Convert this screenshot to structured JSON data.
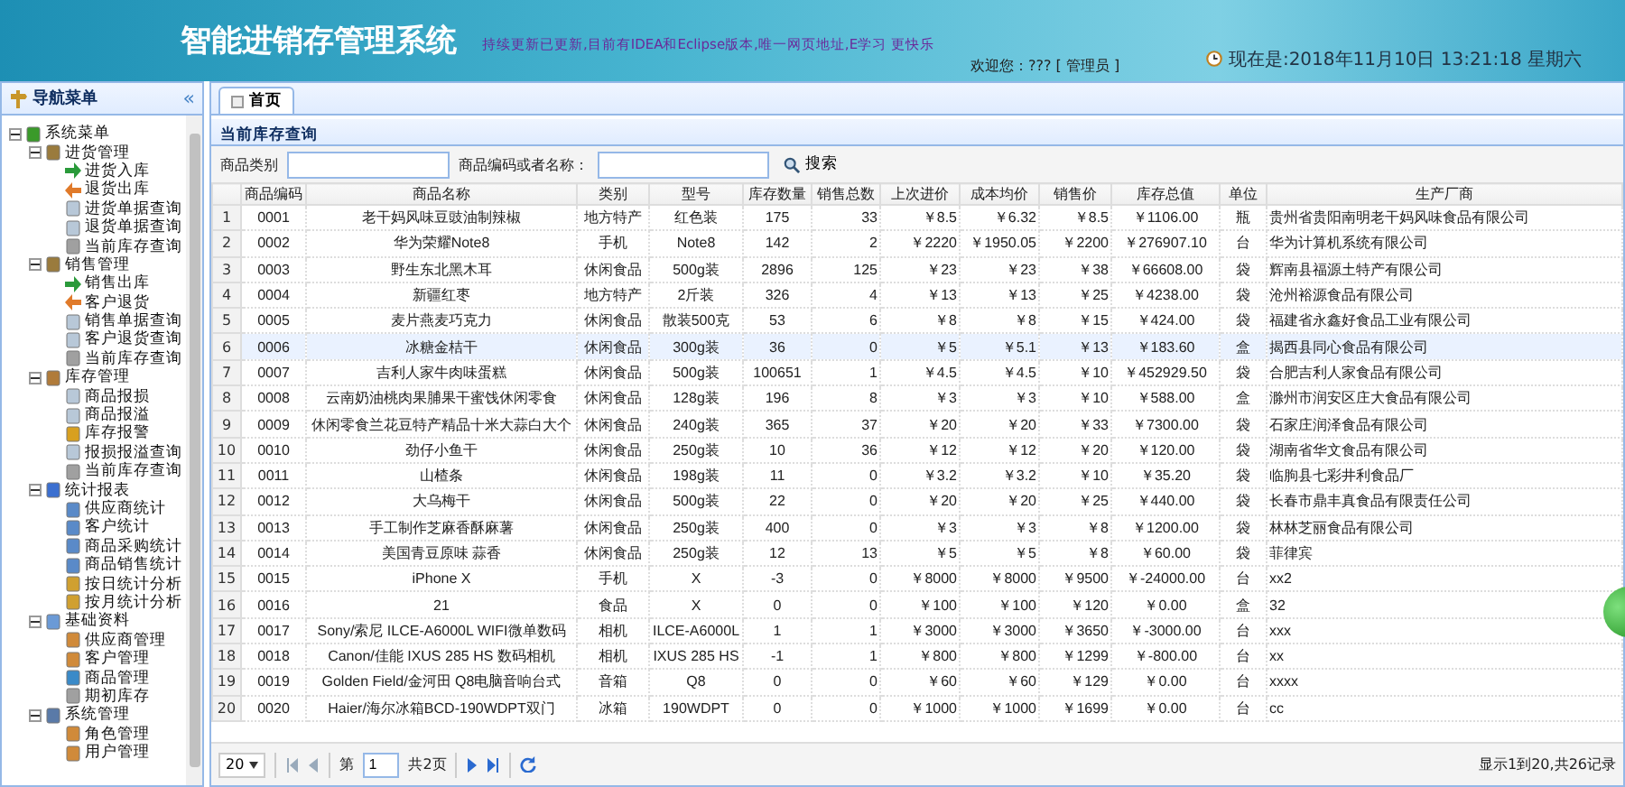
{
  "header": {
    "title": "智能进销存管理系统",
    "notice": "持续更新已更新,目前有IDEA和Eclipse版本,唯一网页地址,E学习 更快乐",
    "welcome": "欢迎您：??? [ 管理员 ]",
    "clock": "现在是:2018年11月10日 13:21:18 星期六"
  },
  "sidebar": {
    "title": "导航菜单",
    "collapse": "«",
    "tree": [
      {
        "label": "系统菜单",
        "expanded": true,
        "kind": "root",
        "children": [
          {
            "label": "进货管理",
            "expanded": true,
            "kind": "group",
            "children": [
              {
                "label": "进货入库",
                "kind": "in"
              },
              {
                "label": "退货出库",
                "kind": "out"
              },
              {
                "label": "进货单据查询",
                "kind": "doc"
              },
              {
                "label": "退货单据查询",
                "kind": "doc"
              },
              {
                "label": "当前库存查询",
                "kind": "db"
              }
            ]
          },
          {
            "label": "销售管理",
            "expanded": true,
            "kind": "group",
            "children": [
              {
                "label": "销售出库",
                "kind": "in"
              },
              {
                "label": "客户退货",
                "kind": "out"
              },
              {
                "label": "销售单据查询",
                "kind": "doc"
              },
              {
                "label": "客户退货查询",
                "kind": "doc"
              },
              {
                "label": "当前库存查询",
                "kind": "db"
              }
            ]
          },
          {
            "label": "库存管理",
            "expanded": true,
            "kind": "folder",
            "children": [
              {
                "label": "商品报损",
                "kind": "doc"
              },
              {
                "label": "商品报溢",
                "kind": "doc"
              },
              {
                "label": "库存报警",
                "kind": "warn"
              },
              {
                "label": "报损报溢查询",
                "kind": "doc"
              },
              {
                "label": "当前库存查询",
                "kind": "db"
              }
            ]
          },
          {
            "label": "统计报表",
            "expanded": true,
            "kind": "chart",
            "children": [
              {
                "label": "供应商统计",
                "kind": "stat"
              },
              {
                "label": "客户统计",
                "kind": "stat"
              },
              {
                "label": "商品采购统计",
                "kind": "stat"
              },
              {
                "label": "商品销售统计",
                "kind": "stat"
              },
              {
                "label": "按日统计分析",
                "kind": "bars"
              },
              {
                "label": "按月统计分析",
                "kind": "bars"
              }
            ]
          },
          {
            "label": "基础资料",
            "expanded": true,
            "kind": "table",
            "children": [
              {
                "label": "供应商管理",
                "kind": "user"
              },
              {
                "label": "客户管理",
                "kind": "user"
              },
              {
                "label": "商品管理",
                "kind": "tree"
              },
              {
                "label": "期初库存",
                "kind": "db"
              }
            ]
          },
          {
            "label": "系统管理",
            "expanded": true,
            "kind": "pc",
            "children": [
              {
                "label": "角色管理",
                "kind": "user"
              },
              {
                "label": "用户管理",
                "kind": "user"
              }
            ]
          }
        ]
      }
    ]
  },
  "tabs": [
    {
      "label": "首页",
      "selected": true
    }
  ],
  "panel": {
    "title": "当前库存查询",
    "search": {
      "category_label": "商品类别",
      "keyword_label": "商品编码或者名称：",
      "button": "搜索"
    },
    "columns": [
      "商品编码",
      "商品名称",
      "类别",
      "型号",
      "库存数量",
      "销售总数",
      "上次进价",
      "成本均价",
      "销售价",
      "库存总值",
      "单位",
      "生产厂商"
    ],
    "rows": [
      {
        "n": "1",
        "cells": [
          "0001",
          "老干妈风味豆豉油制辣椒",
          "地方特产",
          "红色装",
          "175",
          "33",
          "￥8.5",
          "￥6.32",
          "￥8.5",
          "￥1106.00",
          "瓶",
          "贵州省贵阳南明老干妈风味食品有限公司"
        ],
        "selected": false
      },
      {
        "n": "2",
        "cells": [
          "0002",
          "华为荣耀Note8",
          "手机",
          "Note8",
          "142",
          "2",
          "￥2220",
          "￥1950.05",
          "￥2200",
          "￥276907.10",
          "台",
          "华为计算机系统有限公司"
        ],
        "selected": false
      },
      {
        "n": "3",
        "cells": [
          "0003",
          "野生东北黑木耳",
          "休闲食品",
          "500g装",
          "2896",
          "125",
          "￥23",
          "￥23",
          "￥38",
          "￥66608.00",
          "袋",
          "辉南县福源土特产有限公司"
        ],
        "selected": false
      },
      {
        "n": "4",
        "cells": [
          "0004",
          "新疆红枣",
          "地方特产",
          "2斤装",
          "326",
          "4",
          "￥13",
          "￥13",
          "￥25",
          "￥4238.00",
          "袋",
          "沧州裕源食品有限公司"
        ],
        "selected": false
      },
      {
        "n": "5",
        "cells": [
          "0005",
          "麦片燕麦巧克力",
          "休闲食品",
          "散装500克",
          "53",
          "6",
          "￥8",
          "￥8",
          "￥15",
          "￥424.00",
          "袋",
          "福建省永鑫好食品工业有限公司"
        ],
        "selected": false
      },
      {
        "n": "6",
        "cells": [
          "0006",
          "冰糖金桔干",
          "休闲食品",
          "300g装",
          "36",
          "0",
          "￥5",
          "￥5.1",
          "￥13",
          "￥183.60",
          "盒",
          "揭西县同心食品有限公司"
        ],
        "selected": true
      },
      {
        "n": "7",
        "cells": [
          "0007",
          "吉利人家牛肉味蛋糕",
          "休闲食品",
          "500g装",
          "100651",
          "1",
          "￥4.5",
          "￥4.5",
          "￥10",
          "￥452929.50",
          "袋",
          "合肥吉利人家食品有限公司"
        ],
        "selected": false
      },
      {
        "n": "8",
        "cells": [
          "0008",
          "云南奶油桃肉果脯果干蜜饯休闲零食",
          "休闲食品",
          "128g装",
          "196",
          "8",
          "￥3",
          "￥3",
          "￥10",
          "￥588.00",
          "盒",
          "滁州市润安区庄大食品有限公司"
        ],
        "selected": false
      },
      {
        "n": "9",
        "cells": [
          "0009",
          "休闲零食兰花豆特产精品十米大蒜白大个",
          "休闲食品",
          "240g装",
          "365",
          "37",
          "￥20",
          "￥20",
          "￥33",
          "￥7300.00",
          "袋",
          "石家庄润泽食品有限公司"
        ],
        "selected": false
      },
      {
        "n": "10",
        "cells": [
          "0010",
          "劲仔小鱼干",
          "休闲食品",
          "250g装",
          "10",
          "36",
          "￥12",
          "￥12",
          "￥20",
          "￥120.00",
          "袋",
          "湖南省华文食品有限公司"
        ],
        "selected": false
      },
      {
        "n": "11",
        "cells": [
          "0011",
          "山楂条",
          "休闲食品",
          "198g装",
          "11",
          "0",
          "￥3.2",
          "￥3.2",
          "￥10",
          "￥35.20",
          "袋",
          "临朐县七彩井利食品厂"
        ],
        "selected": false
      },
      {
        "n": "12",
        "cells": [
          "0012",
          "大乌梅干",
          "休闲食品",
          "500g装",
          "22",
          "0",
          "￥20",
          "￥20",
          "￥25",
          "￥440.00",
          "袋",
          "长春市鼎丰真食品有限责任公司"
        ],
        "selected": false
      },
      {
        "n": "13",
        "cells": [
          "0013",
          "手工制作芝麻香酥麻薯",
          "休闲食品",
          "250g装",
          "400",
          "0",
          "￥3",
          "￥3",
          "￥8",
          "￥1200.00",
          "袋",
          "林林芝丽食品有限公司"
        ],
        "selected": false
      },
      {
        "n": "14",
        "cells": [
          "0014",
          "美国青豆原味 蒜香",
          "休闲食品",
          "250g装",
          "12",
          "13",
          "￥5",
          "￥5",
          "￥8",
          "￥60.00",
          "袋",
          "菲律宾"
        ],
        "selected": false
      },
      {
        "n": "15",
        "cells": [
          "0015",
          "iPhone X",
          "手机",
          "X",
          "-3",
          "0",
          "￥8000",
          "￥8000",
          "￥9500",
          "￥-24000.00",
          "台",
          "xx2"
        ],
        "selected": false
      },
      {
        "n": "16",
        "cells": [
          "0016",
          "21",
          "食品",
          "X",
          "0",
          "0",
          "￥100",
          "￥100",
          "￥120",
          "￥0.00",
          "盒",
          "32"
        ],
        "selected": false
      },
      {
        "n": "17",
        "cells": [
          "0017",
          "Sony/索尼 ILCE-A6000L WIFI微单数码",
          "相机",
          "ILCE-A6000L",
          "1",
          "1",
          "￥3000",
          "￥3000",
          "￥3650",
          "￥-3000.00",
          "台",
          "xxx"
        ],
        "selected": false
      },
      {
        "n": "18",
        "cells": [
          "0018",
          "Canon/佳能 IXUS 285 HS 数码相机",
          "相机",
          "IXUS 285 HS",
          "-1",
          "1",
          "￥800",
          "￥800",
          "￥1299",
          "￥-800.00",
          "台",
          "xx"
        ],
        "selected": false
      },
      {
        "n": "19",
        "cells": [
          "0019",
          "Golden Field/金河田 Q8电脑音响台式",
          "音箱",
          "Q8",
          "0",
          "0",
          "￥60",
          "￥60",
          "￥129",
          "￥0.00",
          "台",
          "xxxx"
        ],
        "selected": false
      },
      {
        "n": "20",
        "cells": [
          "0020",
          "Haier/海尔冰箱BCD-190WDPT双门",
          "冰箱",
          "190WDPT",
          "0",
          "0",
          "￥1000",
          "￥1000",
          "￥1699",
          "￥0.00",
          "台",
          "cc"
        ],
        "selected": false
      }
    ],
    "pager": {
      "page_size": "20",
      "page_prefix": "第",
      "page": "1",
      "page_total": "共2页",
      "summary": "显示1到20,共26记录"
    }
  }
}
